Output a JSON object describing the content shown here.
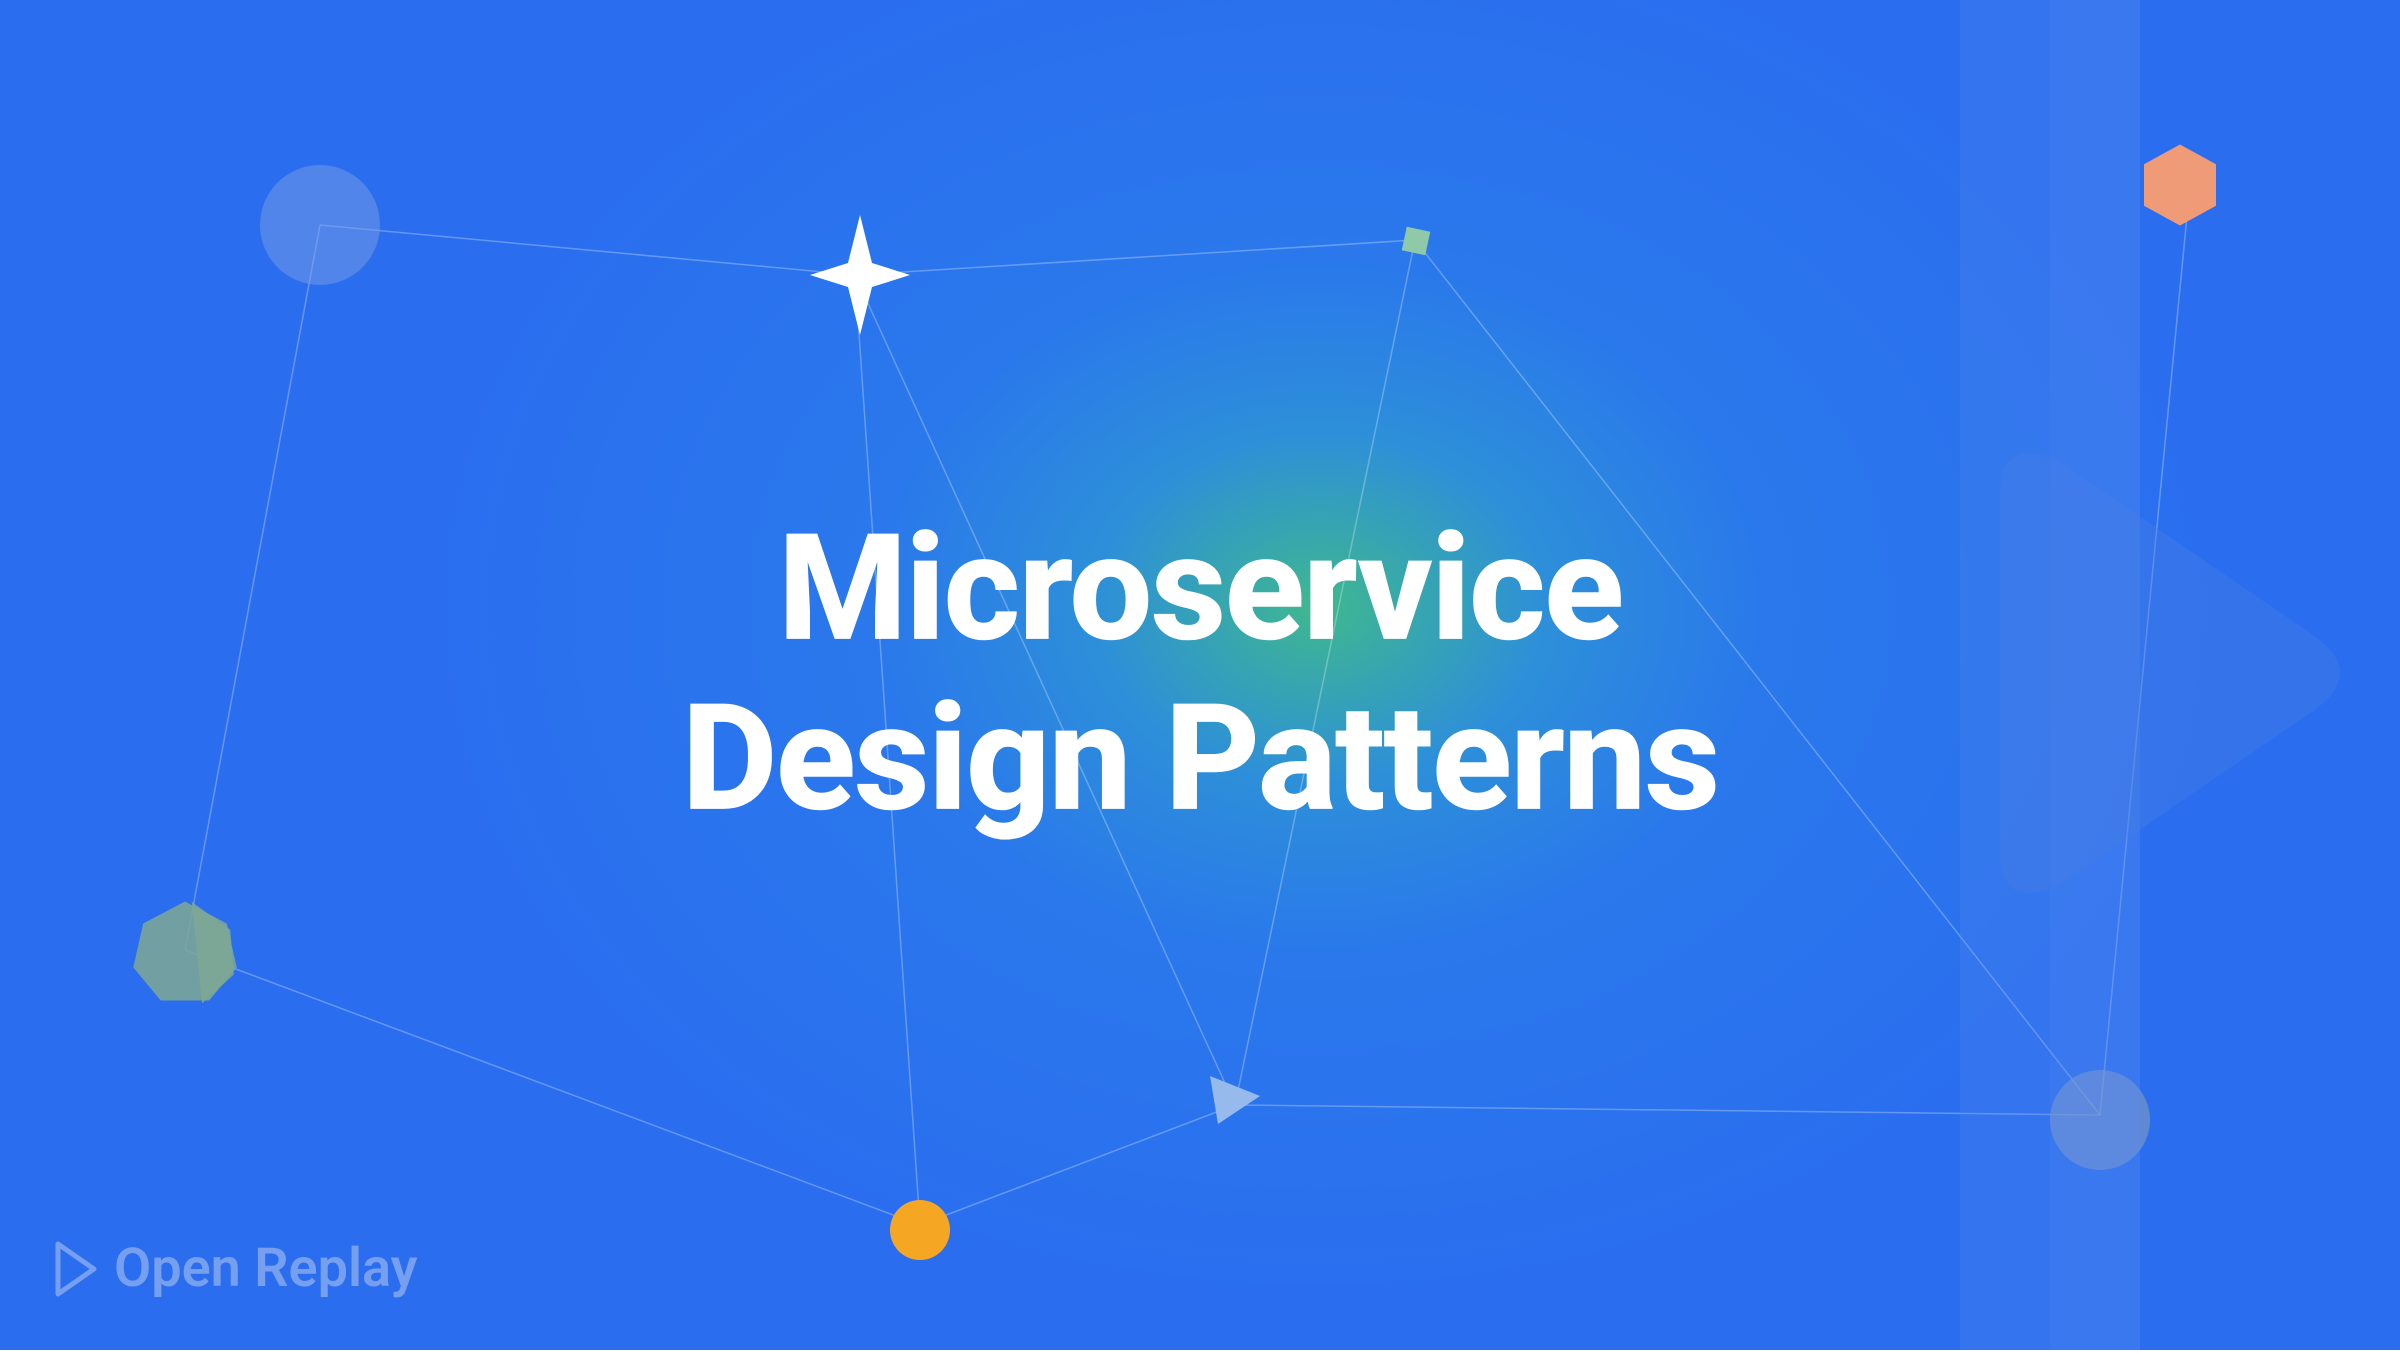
{
  "title_line1": "Microservice",
  "title_line2": "Design Patterns",
  "logo_text": "Open Replay",
  "colors": {
    "bg_gradient_center": "#3fb88f",
    "bg_gradient_outer": "#2a6eef",
    "text": "#ffffff",
    "logo": "rgba(180, 200, 240, 0.55)",
    "orange": "#f5a623",
    "salmon": "#f59b7e",
    "teal_shape": "#7fa896",
    "blue_shape": "rgba(120, 155, 230, 0.5)",
    "gray_shape": "rgba(140, 160, 190, 0.55)",
    "play_overlay": "rgba(80, 130, 230, 0.35)"
  },
  "shapes": {
    "star": "four-point-star",
    "heptagon": "heptagon",
    "hexagon": "hexagon",
    "small_square": "rotated-square",
    "small_triangle": "triangle",
    "circles": [
      "top-left-blue",
      "bottom-orange",
      "bottom-right-gray"
    ]
  }
}
